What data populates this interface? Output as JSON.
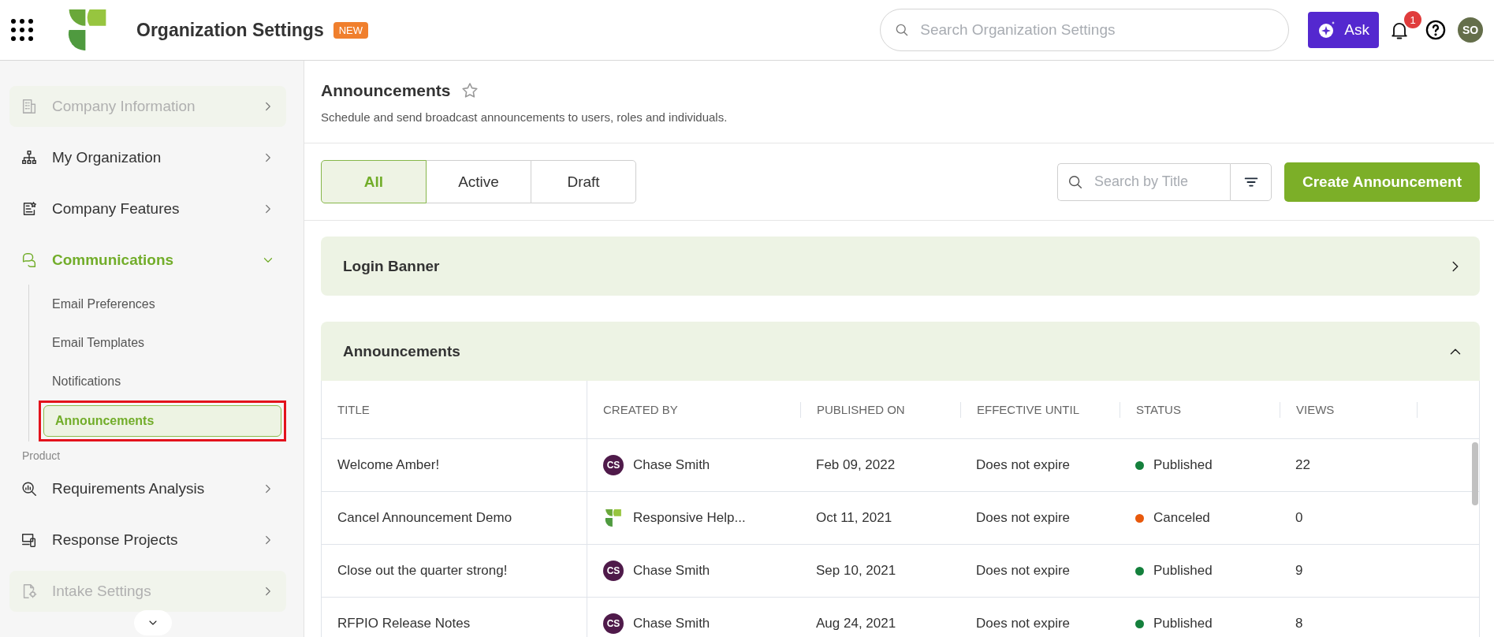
{
  "top_bar": {
    "title": "Organization Settings",
    "badge": "NEW",
    "search": {
      "placeholder": "Search Organization Settings"
    },
    "ask_button": "Ask",
    "notification_count": "1",
    "avatar": "SO"
  },
  "sidebar": {
    "items": [
      {
        "kind": "item",
        "label": "Company Information",
        "dimmed": true,
        "expanded": false,
        "selected": false
      },
      {
        "kind": "item",
        "label": "My Organization",
        "dimmed": false,
        "expanded": false,
        "selected": false
      },
      {
        "kind": "item",
        "label": "Company Features",
        "dimmed": false,
        "expanded": false,
        "selected": false
      },
      {
        "kind": "item",
        "label": "Communications",
        "dimmed": false,
        "expanded": true,
        "selected": true,
        "children": [
          {
            "label": "Email Preferences",
            "selected": false
          },
          {
            "label": "Email Templates",
            "selected": false
          },
          {
            "label": "Notifications",
            "selected": false
          },
          {
            "label": "Announcements",
            "selected": true
          }
        ]
      },
      {
        "kind": "section",
        "label": "Product"
      },
      {
        "kind": "item",
        "label": "Requirements Analysis",
        "dimmed": false,
        "expanded": false,
        "selected": false
      },
      {
        "kind": "item",
        "label": "Response Projects",
        "dimmed": false,
        "expanded": false,
        "selected": false
      },
      {
        "kind": "item",
        "label": "Intake Settings",
        "dimmed": true,
        "expanded": false,
        "selected": false
      }
    ]
  },
  "page": {
    "title": "Announcements",
    "subtitle": "Schedule and send broadcast announcements to users, roles and individuals.",
    "tabs": [
      {
        "label": "All",
        "selected": true
      },
      {
        "label": "Active",
        "selected": false
      },
      {
        "label": "Draft",
        "selected": false
      }
    ],
    "search": {
      "placeholder": "Search by Title"
    },
    "create_button": "Create Announcement",
    "sections": [
      {
        "title": "Login Banner",
        "expanded": false
      },
      {
        "title": "Announcements",
        "expanded": true
      }
    ],
    "table": {
      "columns": [
        "TITLE",
        "CREATED BY",
        "PUBLISHED ON",
        "EFFECTIVE UNTIL",
        "STATUS",
        "VIEWS"
      ],
      "rows": [
        {
          "title": "Welcome Amber!",
          "kind": "initials",
          "creator_initials": "CS",
          "creator": "Chase Smith",
          "published_on": "Feb 09, 2022",
          "effective_until": "Does not expire",
          "status": "Published",
          "color": "#14803c",
          "views": "22"
        },
        {
          "title": "Cancel Announcement Demo",
          "kind": "logo",
          "creator": "Responsive Help...",
          "published_on": "Oct 11, 2021",
          "effective_until": "Does not expire",
          "status": "Canceled",
          "color": "#e8590c",
          "views": "0"
        },
        {
          "title": "Close out the quarter strong!",
          "kind": "initials",
          "creator_initials": "CS",
          "creator": "Chase Smith",
          "published_on": "Sep 10, 2021",
          "effective_until": "Does not expire",
          "status": "Published",
          "color": "#14803c",
          "views": "9"
        },
        {
          "title": "RFPIO Release Notes",
          "kind": "initials",
          "creator_initials": "CS",
          "creator": "Chase Smith",
          "published_on": "Aug 24, 2021",
          "effective_until": "Does not expire",
          "status": "Published",
          "color": "#14803c",
          "views": "8"
        }
      ]
    }
  }
}
